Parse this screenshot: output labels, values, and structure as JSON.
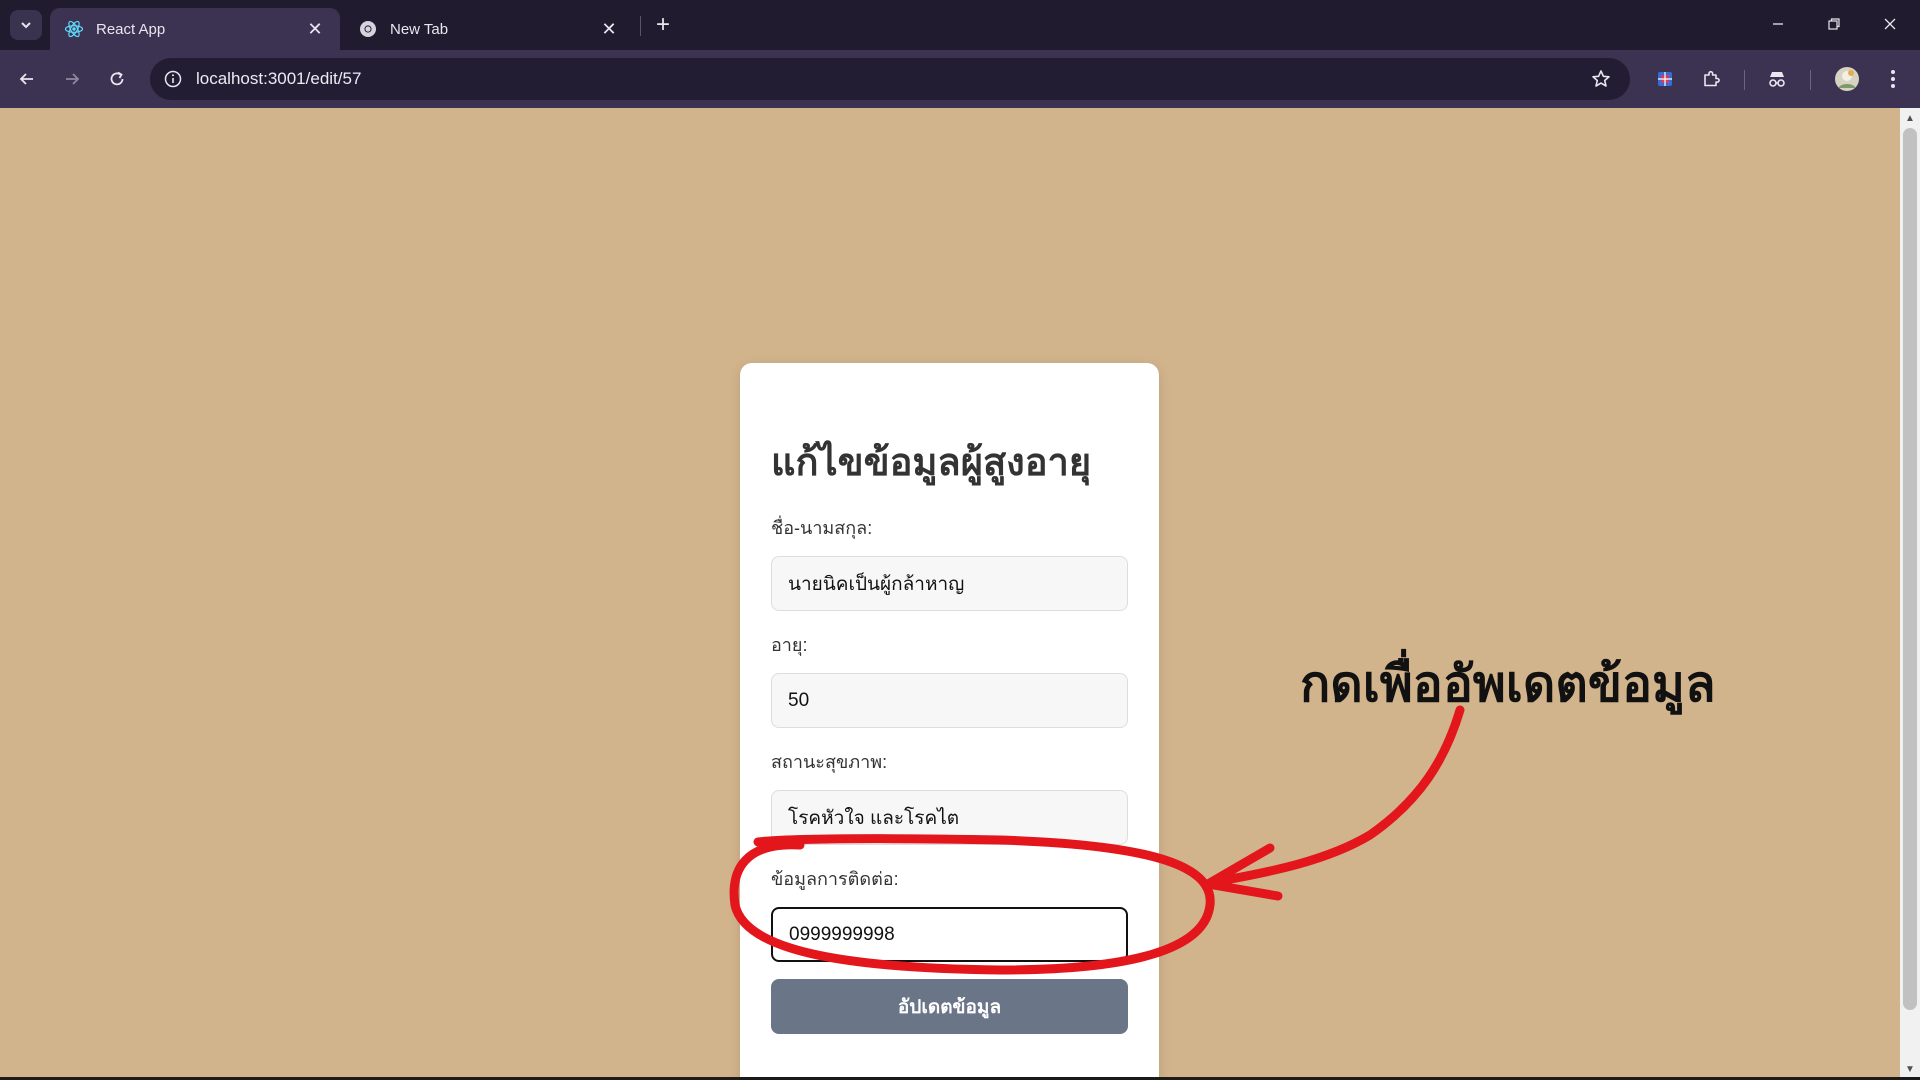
{
  "browser": {
    "tabs": [
      {
        "title": "React App",
        "icon": "react-icon",
        "active": true
      },
      {
        "title": "New Tab",
        "icon": "chrome-icon",
        "active": false
      }
    ],
    "new_tab_label": "+",
    "close_glyph": "✕",
    "url": "localhost:3001/edit/57"
  },
  "form": {
    "title": "แก้ไขข้อมูลผู้สูงอายุ",
    "name_label": "ชื่อ-นามสกุล:",
    "name_value": "นายนิคเป็นผู้กล้าหาญ",
    "age_label": "อายุ:",
    "age_value": "50",
    "health_label": "สถานะสุขภาพ:",
    "health_value": "โรคหัวใจ และโรคไต",
    "contact_label": "ข้อมูลการติดต่อ:",
    "contact_value": "0999999998",
    "submit_label": "อัปเดตข้อมูล"
  },
  "annotation": {
    "text": "กดเพื่ออัพเดตข้อมูล",
    "color": "#e3161c"
  },
  "colors": {
    "page_background": "#d2b48c",
    "button": "#6a7587",
    "tabstrip": "#211b30",
    "toolbar": "#3b3351"
  }
}
